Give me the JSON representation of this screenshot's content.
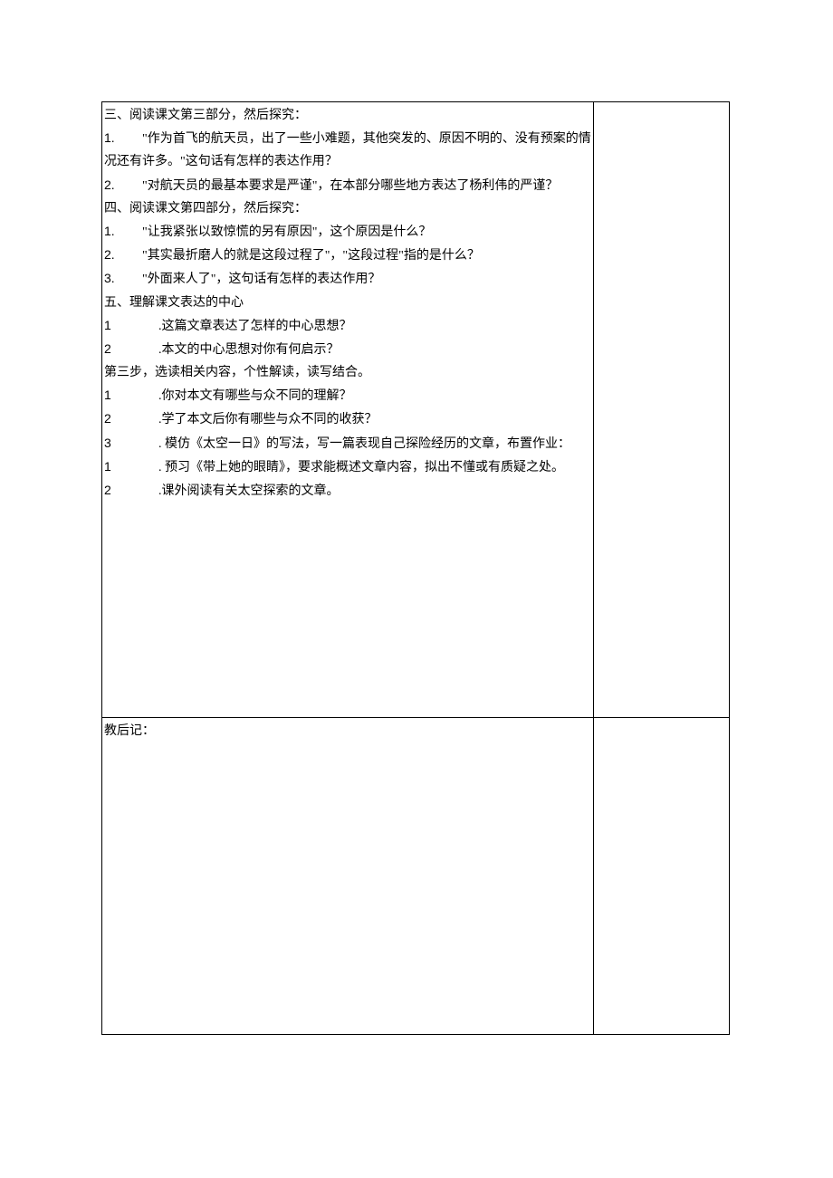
{
  "cell_main_1": {
    "p1": "三、阅读课文第三部分，然后探究：",
    "p2_num": "1.",
    "p2_text": "　　\"作为首飞的航天员，出了一些小难题，其他突发的、原因不明的、没有预案的情况还有许多。\"这句话有怎样的表达作用？",
    "p3_num": "2.",
    "p3_text": "　　\"对航天员的最基本要求是严谨\"，在本部分哪些地方表达了杨利伟的严谨？",
    "p4": "四、阅读课文第四部分，然后探究：",
    "p5_num": "1.",
    "p5_text": "　　\"让我紧张以致惊慌的另有原因\"，这个原因是什么？",
    "p6_num": "2.",
    "p6_text": "　　\"其实最折磨人的就是这段过程了\"，\"这段过程\"指的是什么？",
    "p7_num": "3.",
    "p7_text": "　　\"外面来人了\"，这句话有怎样的表达作用？",
    "p8": "五、理解课文表达的中心",
    "p9_num": "1",
    "p9_text": ".这篇文章表达了怎样的中心思想？",
    "p10_num": "2",
    "p10_text": ".本文的中心思想对你有何启示？",
    "p11": "第三步，选读相关内容，个性解读，读写结合。",
    "p12_num": "1",
    "p12_text": ".你对本文有哪些与众不同的理解？",
    "p13_num": "2",
    "p13_text": ".学了本文后你有哪些与众不同的收获？",
    "p14_num": "3",
    "p14_text": ". 模仿《太空一日》的写法，写一篇表现自己探险经历的文章，布置作业：",
    "p15_num": "1",
    "p15_text": ". 预习《带上她的眼睛》，要求能概述文章内容，拟出不懂或有质疑之处。",
    "p16_num": "2",
    "p16_text": ".课外阅读有关太空探索的文章。"
  },
  "cell_main_2": {
    "label": "教后记："
  }
}
